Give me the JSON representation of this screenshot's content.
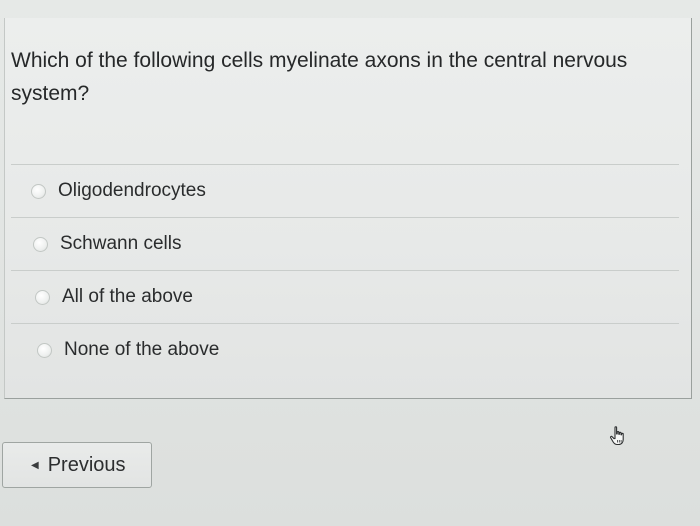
{
  "question": {
    "text": "Which of the following cells myelinate axons in the central nervous system?"
  },
  "choices": [
    {
      "label": "Oligodendrocytes"
    },
    {
      "label": "Schwann cells"
    },
    {
      "label": "All of the above"
    },
    {
      "label": "None of the above"
    }
  ],
  "navigation": {
    "previous_label": "Previous",
    "previous_icon": "triangle-left-icon"
  },
  "cursor": {
    "icon": "hand-pointer-icon"
  }
}
